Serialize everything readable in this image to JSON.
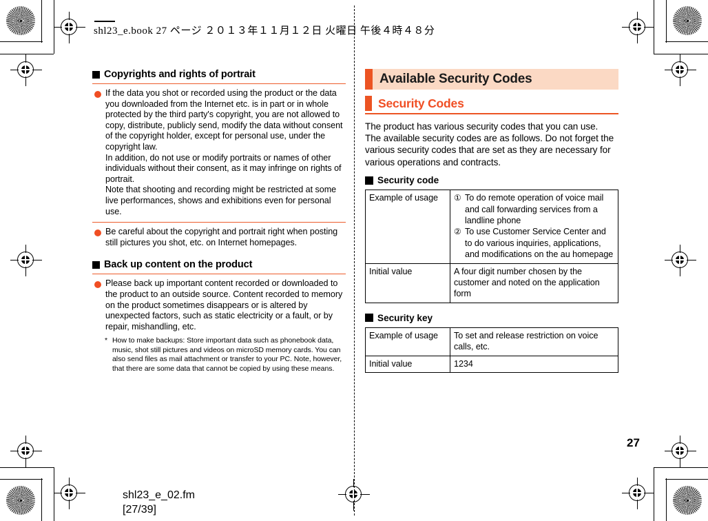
{
  "page": {
    "header_line": "shl23_e.book   27 ページ   ２０１３年１１月１２日   火曜日   午後４時４８分",
    "footer_file": "shl23_e_02.fm",
    "footer_pages": "[27/39]",
    "page_number": "27",
    "colors": {
      "accent_orange": "#F04E23",
      "banner_bg": "#FBD9C4",
      "rule_orange": "#EC5423"
    }
  },
  "left_column": {
    "sections": [
      {
        "heading": "Copyrights and rights of portrait",
        "bullets": [
          "If the data you shot or recorded using the product or the data you downloaded from the Internet etc. is in part or in whole protected by the third party's copyright, you are not allowed to copy, distribute, publicly send, modify the data without consent of the copyright holder, except for personal use, under the copyright law.\nIn addition, do not use or modify portraits or names of other individuals without their consent, as it may infringe on rights of portrait.\nNote that shooting and recording might be restricted at some live performances, shows and exhibitions even for personal use.",
          "Be careful about the copyright and portrait right when posting still pictures you shot, etc. on Internet homepages."
        ]
      },
      {
        "heading": "Back up content on the product",
        "bullets": [
          "Please back up important content recorded or downloaded to the product to an outside source. Content recorded to memory on the product sometimes disappears or is altered by unexpected factors, such as static electricity or a fault, or by repair, mishandling, etc."
        ],
        "note_marker": "*",
        "note": "How to make backups: Store important data such as phonebook data, music, shot still pictures and videos on microSD memory cards. You can also send files as mail attachment or transfer to your PC. Note, however, that there are some data that cannot be copied by using these means."
      }
    ]
  },
  "right_column": {
    "banner_title": "Available Security Codes",
    "sub_banner_title": "Security Codes",
    "intro": "The product has various security codes that you can use.\nThe available security codes are as follows. Do not forget the various security codes that are set as they are necessary for various operations and contracts.",
    "security_code": {
      "heading": "Security code",
      "rows": [
        {
          "label": "Example of usage",
          "items": [
            {
              "marker": "①",
              "text": "To do remote operation of voice mail and call forwarding services from a landline phone"
            },
            {
              "marker": "②",
              "text": "To use Customer Service Center and to do various inquiries, applications, and modifications on the au homepage"
            }
          ]
        },
        {
          "label": "Initial value",
          "value": "A four digit number chosen by the customer and noted on the application form"
        }
      ]
    },
    "security_key": {
      "heading": "Security key",
      "rows": [
        {
          "label": "Example of usage",
          "value": "To set and release restriction on voice calls, etc."
        },
        {
          "label": "Initial value",
          "value": "1234"
        }
      ]
    }
  }
}
